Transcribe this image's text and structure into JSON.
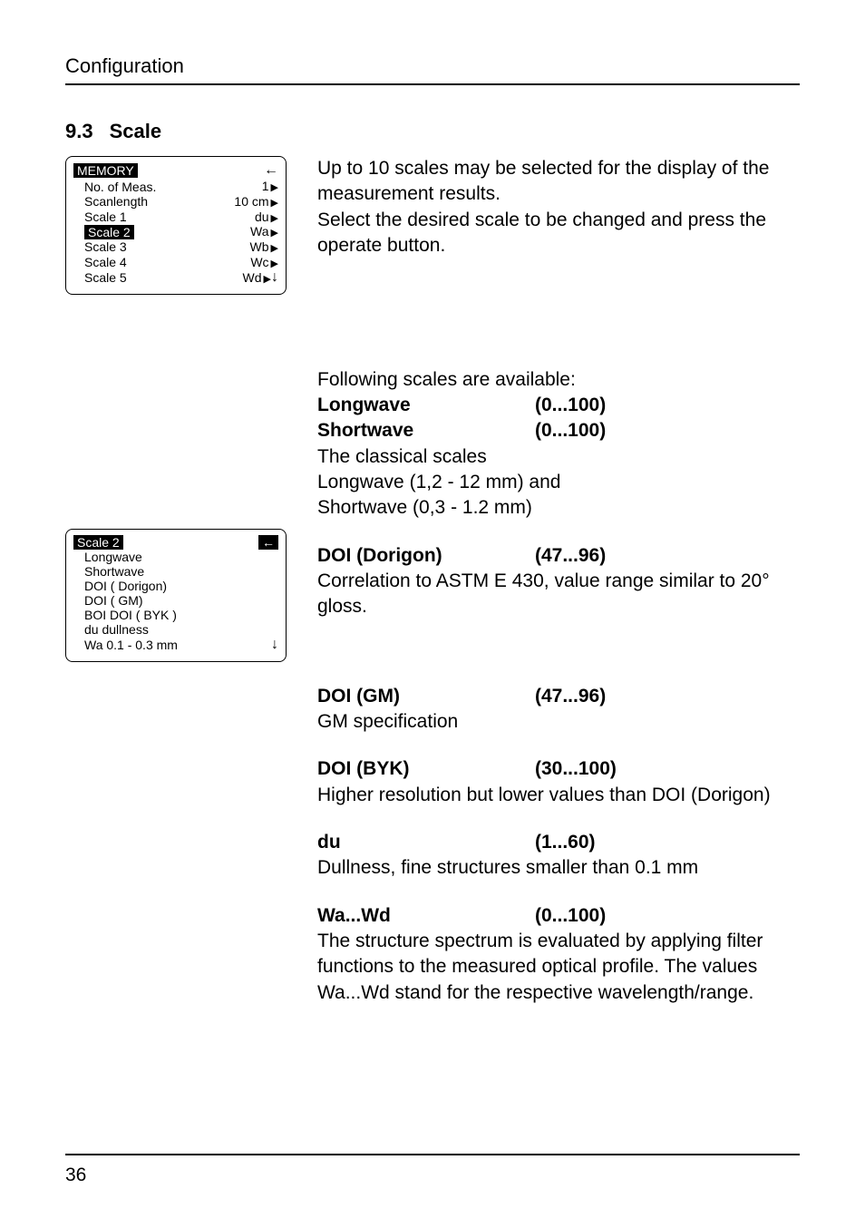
{
  "header": {
    "running": "Configuration"
  },
  "section": {
    "number": "9.3",
    "title": "Scale"
  },
  "intro": {
    "p1": "Up to 10 scales may be selected for the display of the measurement results.",
    "p2": "Select the desired scale to be changed and press the operate button."
  },
  "lcd_memory": {
    "title": "MEMORY",
    "rows": [
      {
        "label": "No. of Meas.",
        "value": "1",
        "tri": true,
        "selected": false
      },
      {
        "label": "Scanlength",
        "value": "10  cm",
        "tri": true,
        "selected": false
      },
      {
        "label": "Scale  1",
        "value": "du",
        "tri": true,
        "selected": false
      },
      {
        "label": "Scale  2",
        "value": "Wa",
        "tri": true,
        "selected": true
      },
      {
        "label": "Scale  3",
        "value": "Wb",
        "tri": true,
        "selected": false
      },
      {
        "label": "Scale  4",
        "value": "Wc",
        "tri": true,
        "selected": false
      },
      {
        "label": "Scale  5",
        "value": "Wd",
        "tri": true,
        "selected": false
      }
    ]
  },
  "lcd_scale2": {
    "title": "Scale 2",
    "items": [
      "Longwave",
      "Shortwave",
      "DOI   ( Dorigon)",
      "DOI   ( GM)",
      "BOI DOI  ( BYK )",
      "du   dullness",
      "Wa  0.1 - 0.3 mm"
    ]
  },
  "scales_intro": "Following scales are available:",
  "scales": {
    "longwave": {
      "name": "Longwave",
      "range": "(0...100)"
    },
    "shortwave": {
      "name": "Shortwave",
      "range": "(0...100)"
    },
    "classical_l1": "The classical scales",
    "classical_l2": "Longwave (1,2 - 12 mm) and",
    "classical_l3": "Shortwave (0,3 - 1.2 mm)",
    "doi_dorigon": {
      "name": "DOI (Dorigon)",
      "range": "(47...96)",
      "desc": "Correlation to ASTM E 430, value range similar to 20° gloss."
    },
    "doi_gm": {
      "name": "DOI (GM)",
      "range": "(47...96)",
      "desc": "GM specification"
    },
    "doi_byk": {
      "name": "DOI (BYK)",
      "range": "(30...100)",
      "desc": "Higher resolution but lower values than DOI (Dorigon)"
    },
    "du": {
      "name": "du",
      "range": "(1...60)",
      "desc": "Dullness, fine structures smaller than 0.1 mm"
    },
    "wa_wd": {
      "name": "Wa...Wd",
      "range": "(0...100)",
      "desc": "The structure spectrum is evaluated by applying filter functions to the measured optical profile. The values Wa...Wd stand for the respective wavelength/range."
    }
  },
  "footer": {
    "page": "36"
  }
}
